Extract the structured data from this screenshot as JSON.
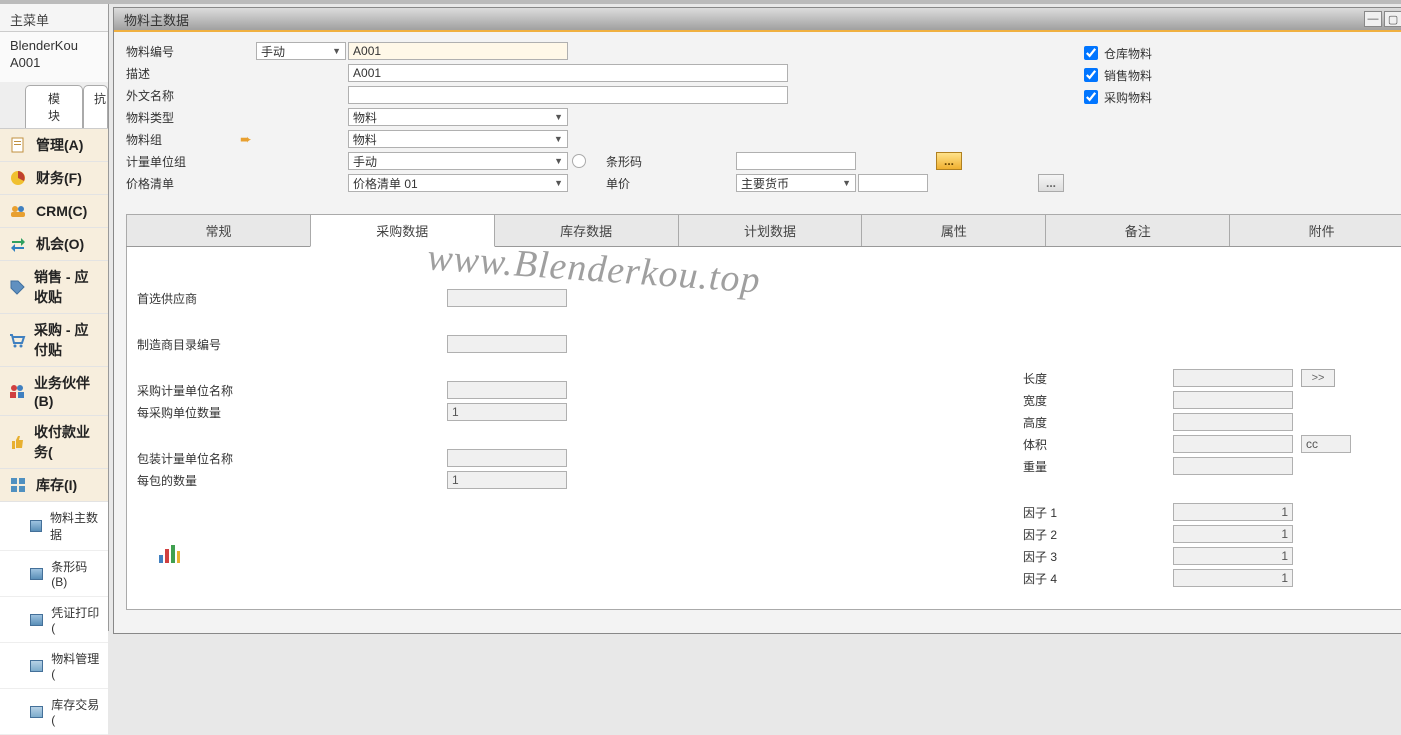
{
  "sidebar": {
    "title": "主菜单",
    "username": "BlenderKou",
    "usercode": "A001",
    "tabs": {
      "main": "模块",
      "other": "抗"
    },
    "items": [
      {
        "label": "管理(A)",
        "icon": "doc"
      },
      {
        "label": "财务(F)",
        "icon": "pie"
      },
      {
        "label": "CRM(C)",
        "icon": "users"
      },
      {
        "label": "机会(O)",
        "icon": "swap"
      },
      {
        "label": "销售 - 应收贴",
        "icon": "tag"
      },
      {
        "label": "采购 - 应付贴",
        "icon": "cart"
      },
      {
        "label": "业务伙伴(B)",
        "icon": "partners"
      },
      {
        "label": "收付款业务(",
        "icon": "thumbs"
      },
      {
        "label": "库存(I)",
        "icon": "grid"
      }
    ],
    "subitems": [
      {
        "label": "物料主数据",
        "folder": false
      },
      {
        "label": "条形码(B)",
        "folder": false
      },
      {
        "label": "凭证打印(",
        "folder": false
      },
      {
        "label": "物料管理(",
        "folder": true
      },
      {
        "label": "库存交易(",
        "folder": true
      }
    ]
  },
  "window": {
    "title": "物料主数据"
  },
  "header": {
    "item_no_label": "物料编号",
    "item_no_mode": "手动",
    "item_no_value": "A001",
    "desc_label": "描述",
    "desc_value": "A001",
    "foreign_label": "外文名称",
    "foreign_value": "",
    "type_label": "物料类型",
    "type_value": "物料",
    "group_label": "物料组",
    "group_value": "物料",
    "uom_label": "计量单位组",
    "uom_value": "手动",
    "barcode_label": "条形码",
    "barcode_value": "",
    "pricelist_label": "价格清单",
    "pricelist_value": "价格清单 01",
    "unitprice_label": "单价",
    "unitprice_currency": "主要货币",
    "unitprice_value": "",
    "check1": "仓库物料",
    "check2": "销售物料",
    "check3": "采购物料"
  },
  "tabs": {
    "t1": "常规",
    "t2": "采购数据",
    "t3": "库存数据",
    "t4": "计划数据",
    "t5": "属性",
    "t6": "备注",
    "t7": "附件"
  },
  "watermark": "www.Blenderkou.top",
  "purchasing": {
    "pref_vendor_label": "首选供应商",
    "pref_vendor_value": "",
    "mfr_cat_label": "制造商目录编号",
    "mfr_cat_value": "",
    "puom_label": "采购计量单位名称",
    "puom_value": "",
    "per_pu_label": "每采购单位数量",
    "per_pu_value": "1",
    "pack_uom_label": "包装计量单位名称",
    "pack_uom_value": "",
    "per_pack_label": "每包的数量",
    "per_pack_value": "1",
    "length_label": "长度",
    "width_label": "宽度",
    "height_label": "高度",
    "volume_label": "体积",
    "volume_unit": "cc",
    "weight_label": "重量",
    "expand": ">>",
    "f1_label": "因子 1",
    "f1_value": "1",
    "f2_label": "因子 2",
    "f2_value": "1",
    "f3_label": "因子 3",
    "f3_value": "1",
    "f4_label": "因子 4",
    "f4_value": "1"
  },
  "ellipsis": "..."
}
